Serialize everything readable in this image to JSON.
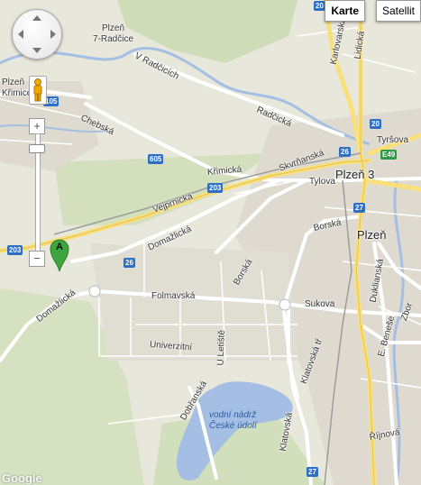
{
  "map_type_control": {
    "map_label": "Karte",
    "satellite_label": "Satellit",
    "selected": "Karte"
  },
  "places": {
    "plzen_7_1": "Plzeň",
    "plzen_7_2": "7-Radčice",
    "plzen_krimice_1": "Plzeň",
    "plzen_krimice_2": "Křimice",
    "plzen_3": "Plzeň 3",
    "plzen": "Plzeň"
  },
  "streets": {
    "v_radcicich": "V Radčicích",
    "radcicka": "Radčická",
    "chebska": "Chebská",
    "krimicka": "Křimická",
    "skvrnanska": "Skvrňanská",
    "tylova": "Tylova",
    "vejprnicka": "Vejprnická",
    "domazlicka_1": "Domažlická",
    "domazlicka_2": "Domažlická",
    "borska_1": "Borská",
    "borska_2": "Borská",
    "folmavska": "Folmavská",
    "sukova": "Sukova",
    "univerzitni": "Univerzitní",
    "u_letiste": "U Letiště",
    "klatovska_tr": "Klatovská tř",
    "klatovska": "Klatovská",
    "dobranska": "Dobřanská",
    "karlovarska": "Karlovarská",
    "lidicka": "Lidická",
    "tyrsova": "Tyršova",
    "duklianska": "Duklianská",
    "e_benese": "E. Beneše",
    "zborovska": "Zbor",
    "rijnova": "Říjnová"
  },
  "water": {
    "reservoir_1": "vodní nádrž",
    "reservoir_2": "České údolí"
  },
  "shields": {
    "r105": "105",
    "r605": "605",
    "r203a": "203",
    "r203b": "203",
    "r26a": "26",
    "r26b": "26",
    "r20a": "20",
    "r20b": "20",
    "r27a": "27",
    "r27b": "27",
    "e49": "E49"
  },
  "marker": {
    "letter": "A"
  },
  "logo": "Google",
  "colors": {
    "land": "#e8e7dc",
    "forest": "#cbd9b3",
    "water": "#a4bfe3",
    "urban": "#dedad0",
    "road": "#ffffff",
    "major_road": "#f9e07a",
    "shield": "#2f6fc3",
    "marker": "#3fa53f"
  }
}
